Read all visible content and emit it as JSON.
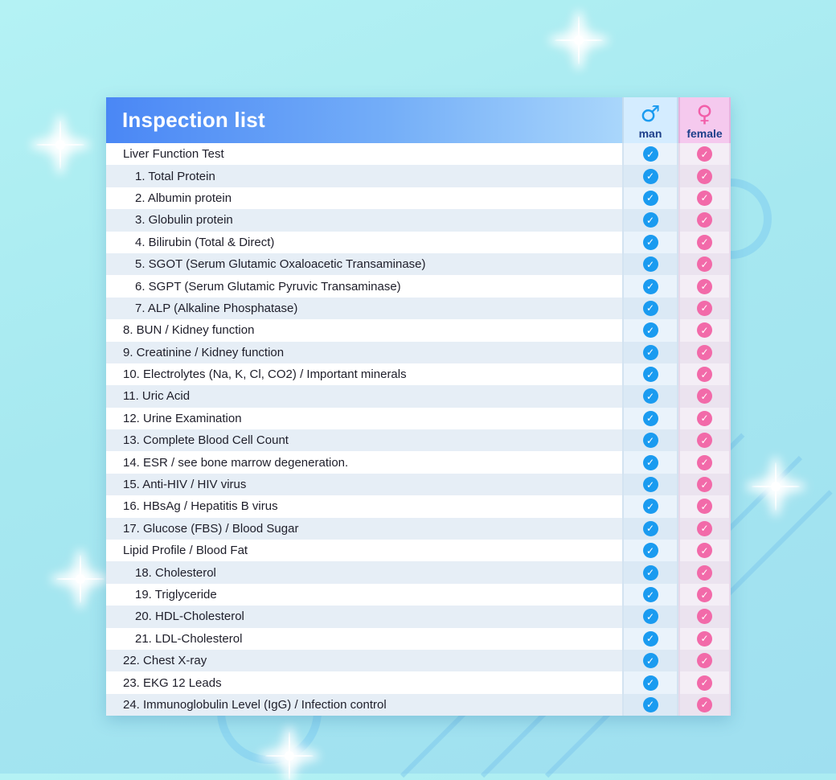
{
  "title": "Inspection list",
  "columns": {
    "man": {
      "symbol": "♂",
      "label": "man",
      "icon": "male-symbol-icon",
      "color": "#1a9bf0"
    },
    "female": {
      "symbol": "♀",
      "label": "female",
      "icon": "female-symbol-icon",
      "color": "#f26aa9"
    }
  },
  "check_glyph": "✓",
  "rows": [
    {
      "label": "Liver Function Test",
      "indent": 0,
      "man": true,
      "female": true
    },
    {
      "label": "1. Total Protein",
      "indent": 1,
      "man": true,
      "female": true
    },
    {
      "label": "2. Albumin protein",
      "indent": 1,
      "man": true,
      "female": true
    },
    {
      "label": "3. Globulin protein",
      "indent": 1,
      "man": true,
      "female": true
    },
    {
      "label": "4. Bilirubin (Total & Direct)",
      "indent": 1,
      "man": true,
      "female": true
    },
    {
      "label": "5. SGOT (Serum Glutamic Oxaloacetic Transaminase)",
      "indent": 1,
      "man": true,
      "female": true
    },
    {
      "label": "6. SGPT (Serum Glutamic Pyruvic Transaminase)",
      "indent": 1,
      "man": true,
      "female": true
    },
    {
      "label": "7. ALP (Alkaline Phosphatase)",
      "indent": 1,
      "man": true,
      "female": true
    },
    {
      "label": "8. BUN / Kidney function",
      "indent": 0,
      "man": true,
      "female": true
    },
    {
      "label": "9. Creatinine / Kidney function",
      "indent": 0,
      "man": true,
      "female": true
    },
    {
      "label": "10. Electrolytes (Na, K, Cl, CO2) / Important minerals",
      "indent": 0,
      "man": true,
      "female": true
    },
    {
      "label": "11. Uric Acid",
      "indent": 0,
      "man": true,
      "female": true
    },
    {
      "label": "12. Urine Examination",
      "indent": 0,
      "man": true,
      "female": true
    },
    {
      "label": "13. Complete Blood Cell Count",
      "indent": 0,
      "man": true,
      "female": true
    },
    {
      "label": "14. ESR / see bone marrow degeneration.",
      "indent": 0,
      "man": true,
      "female": true
    },
    {
      "label": "15. Anti-HIV / HIV virus",
      "indent": 0,
      "man": true,
      "female": true
    },
    {
      "label": "16. HBsAg / Hepatitis B virus",
      "indent": 0,
      "man": true,
      "female": true
    },
    {
      "label": "17. Glucose (FBS) / Blood Sugar",
      "indent": 0,
      "man": true,
      "female": true
    },
    {
      "label": "Lipid Profile / Blood Fat",
      "indent": 0,
      "man": true,
      "female": true
    },
    {
      "label": "18. Cholesterol",
      "indent": 1,
      "man": true,
      "female": true
    },
    {
      "label": "19. Triglyceride",
      "indent": 1,
      "man": true,
      "female": true
    },
    {
      "label": "20. HDL-Cholesterol",
      "indent": 1,
      "man": true,
      "female": true
    },
    {
      "label": "21. LDL-Cholesterol",
      "indent": 1,
      "man": true,
      "female": true
    },
    {
      "label": "22. Chest X-ray",
      "indent": 0,
      "man": true,
      "female": true
    },
    {
      "label": "23. EKG 12 Leads",
      "indent": 0,
      "man": true,
      "female": true
    },
    {
      "label": "24. Immunoglobulin Level (IgG) / Infection control",
      "indent": 0,
      "man": true,
      "female": true
    }
  ]
}
